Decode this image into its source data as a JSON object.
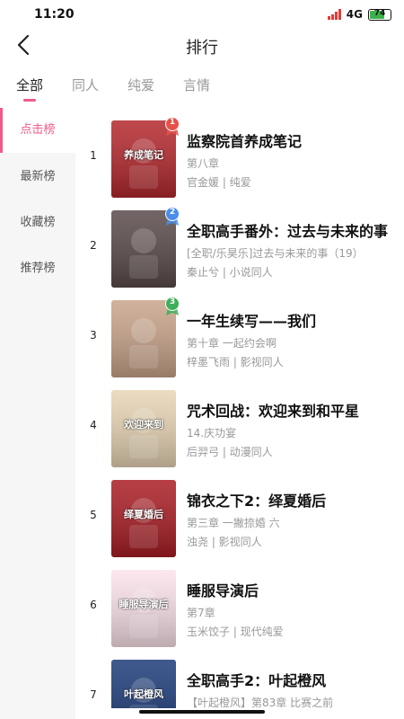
{
  "status": {
    "time": "11:20",
    "network": "4G",
    "battery": "74",
    "battery_level": 0.74,
    "signal_color": "#e53935",
    "battery_color": "#3bb24a"
  },
  "header": {
    "title": "排行"
  },
  "tabs": [
    {
      "label": "全部",
      "active": true
    },
    {
      "label": "同人",
      "active": false
    },
    {
      "label": "纯爱",
      "active": false
    },
    {
      "label": "言情",
      "active": false
    }
  ],
  "sidebar": {
    "items": [
      {
        "label": "点击榜",
        "active": true
      },
      {
        "label": "最新榜",
        "active": false
      },
      {
        "label": "收藏榜",
        "active": false
      },
      {
        "label": "推荐榜",
        "active": false
      }
    ]
  },
  "accent_color": "#f05b8a",
  "books": [
    {
      "rank": "1",
      "title": "监察院首养成笔记",
      "chapter": "第八章",
      "meta": "官金媛 | 纯爱",
      "badge": "1",
      "cover_color": "#b3282d",
      "cover_text": "养成笔记"
    },
    {
      "rank": "2",
      "title": "全职高手番外：过去与未来的事",
      "chapter": "[全职/乐昊乐]过去与未来的事（19）",
      "meta": "秦止兮 | 小说同人",
      "badge": "2",
      "cover_color": "#5a4a4a",
      "cover_text": ""
    },
    {
      "rank": "3",
      "title": "一年生续写——我们",
      "chapter": "第十章 一起约会啊",
      "meta": "梓墨飞雨 | 影视同人",
      "badge": "3",
      "cover_color": "#c9a48a",
      "cover_text": ""
    },
    {
      "rank": "4",
      "title": "咒术回战：欢迎来到和平星",
      "chapter": "14.庆功宴",
      "meta": "后羿弓 | 动漫同人",
      "badge": "",
      "cover_color": "#e8d5b5",
      "cover_text": "欢迎来到"
    },
    {
      "rank": "5",
      "title": "锦衣之下2：绎夏婚后",
      "chapter": "第三章 一撇捺婚 六",
      "meta": "浊尧 | 影视同人",
      "badge": "",
      "cover_color": "#a81d24",
      "cover_text": "绎夏婚后"
    },
    {
      "rank": "6",
      "title": "睡服导演后",
      "chapter": "第7章",
      "meta": "玉米饺子 | 现代纯爱",
      "badge": "",
      "cover_color": "#fbe3ea",
      "cover_text": "睡服导演后"
    },
    {
      "rank": "7",
      "title": "全职高手2：叶起橙风",
      "chapter": "【叶起橙风】第83章 比赛之前",
      "meta": "",
      "badge": "",
      "cover_color": "#1d3c7a",
      "cover_text": "叶起橙风"
    }
  ]
}
